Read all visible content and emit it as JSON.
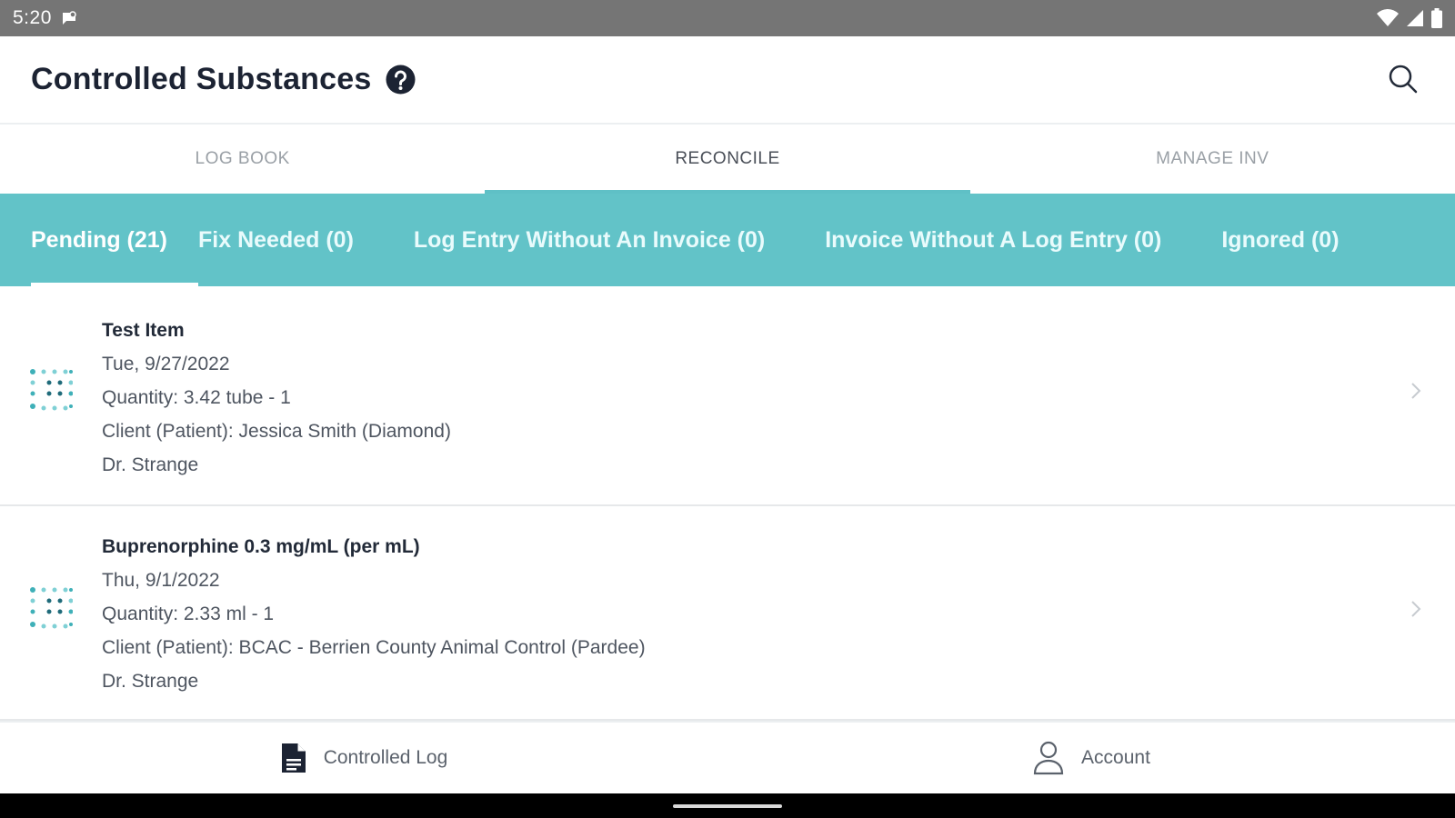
{
  "status_bar": {
    "time": "5:20"
  },
  "header": {
    "title": "Controlled Substances"
  },
  "main_tabs": [
    {
      "label": "LOG BOOK"
    },
    {
      "label": "RECONCILE"
    },
    {
      "label": "MANAGE INV"
    }
  ],
  "sub_tabs": [
    {
      "label": "Pending  (21)"
    },
    {
      "label": "Fix Needed  (0)"
    },
    {
      "label": "Log Entry Without An Invoice  (0)"
    },
    {
      "label": "Invoice Without A Log Entry  (0)"
    },
    {
      "label": "Ignored  (0)"
    }
  ],
  "items": [
    {
      "name": "Test Item",
      "date": "Tue, 9/27/2022",
      "quantity": "Quantity: 3.42 tube - 1",
      "client": "Client (Patient): Jessica Smith (Diamond)",
      "doctor": "Dr. Strange"
    },
    {
      "name": "Buprenorphine 0.3 mg/mL (per mL)",
      "date": "Thu, 9/1/2022",
      "quantity": "Quantity: 2.33 ml - 1",
      "client": "Client (Patient): BCAC - Berrien County Animal Control (Pardee)",
      "doctor": "Dr. Strange"
    }
  ],
  "bottom_nav": [
    {
      "label": "Controlled Log",
      "icon": "document-icon"
    },
    {
      "label": "Account",
      "icon": "person-icon"
    }
  ],
  "colors": {
    "accent": "#62c3c8",
    "title": "#1c2333",
    "status_bar": "#757575"
  }
}
